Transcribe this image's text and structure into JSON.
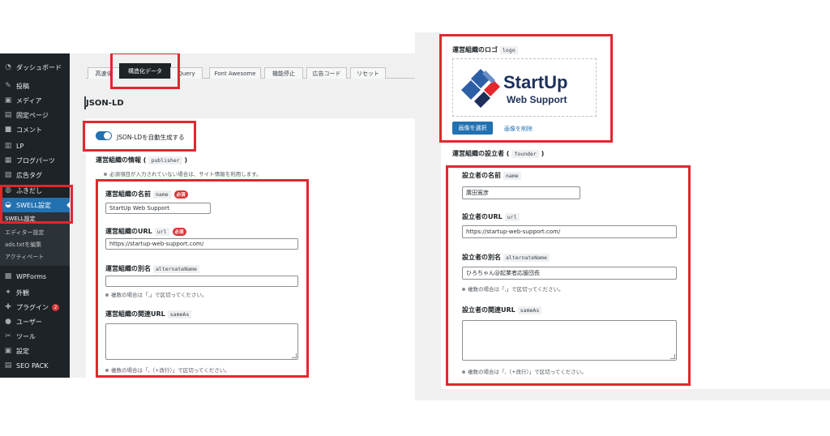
{
  "sidebar": {
    "items": [
      {
        "icon": "dashboard-icon",
        "glyph": "◔",
        "label": "ダッシュボード"
      },
      {
        "icon": "pin-icon",
        "glyph": "✎",
        "label": "投稿"
      },
      {
        "icon": "media-icon",
        "glyph": "▣",
        "label": "メディア"
      },
      {
        "icon": "page-icon",
        "glyph": "▤",
        "label": "固定ページ"
      },
      {
        "icon": "comment-icon",
        "glyph": "■",
        "label": "コメント"
      },
      {
        "icon": "lp-icon",
        "glyph": "▥",
        "label": "LP"
      },
      {
        "icon": "blog-parts-icon",
        "glyph": "▦",
        "label": "ブログパーツ"
      },
      {
        "icon": "ad-tag-icon",
        "glyph": "▧",
        "label": "広告タグ"
      },
      {
        "icon": "balloon-icon",
        "glyph": "◍",
        "label": "ふきだし"
      },
      {
        "icon": "swell-icon",
        "glyph": "◒",
        "label": "SWELL設定"
      }
    ],
    "submenu_head": "SWELL設定",
    "submenu": [
      "エディター設定",
      "ads.txtを編集",
      "アクティベート"
    ],
    "items2": [
      {
        "icon": "wpforms-icon",
        "glyph": "▩",
        "label": "WPForms"
      },
      {
        "icon": "appearance-icon",
        "glyph": "✦",
        "label": "外観"
      },
      {
        "icon": "plugin-icon",
        "glyph": "✚",
        "label": "プラグイン",
        "badge": "2"
      },
      {
        "icon": "users-icon",
        "glyph": "●",
        "label": "ユーザー"
      },
      {
        "icon": "tools-icon",
        "glyph": "✂",
        "label": "ツール"
      },
      {
        "icon": "settings-icon",
        "glyph": "▣",
        "label": "設定"
      },
      {
        "icon": "seo-pack-icon",
        "glyph": "▤",
        "label": "SEO PACK"
      }
    ]
  },
  "tabs": [
    "高速化",
    "構造化データ",
    "Query",
    "Font Awesome",
    "機能停止",
    "広告コード",
    "リセット"
  ],
  "section_title": "JSON-LD",
  "toggle_label": "JSON-LDを自動生成する",
  "publisher": {
    "heading": "運営組織の情報",
    "code": "publisher",
    "note": "必須項目が入力されていない場合は、サイト情報を利用します。",
    "name_label": "運営組織の名前",
    "name_code": "name",
    "required": "必須",
    "name_value": "StartUp Web Support",
    "url_label": "運営組織のURL",
    "url_code": "url",
    "url_value": "https://startup-web-support.com/",
    "alt_label": "運営組織の別名",
    "alt_code": "alternateName",
    "alt_note": "複数の場合は「,」で区切ってください。",
    "sameas_label": "運営組織の関連URL",
    "sameas_code": "sameAs",
    "sameas_note": "複数の場合は「,（+改行）」で区切ってください。"
  },
  "logo": {
    "label": "運営組織のロゴ",
    "code": "logo",
    "brand_line1": "StartUp",
    "brand_line2": "Web Support",
    "select_button": "画像を選択",
    "delete_button": "画像を削除"
  },
  "founder": {
    "heading": "運営組織の設立者",
    "code": "founder",
    "name_label": "設立者の名前",
    "name_code": "name",
    "name_value": "廣田寛彦",
    "url_label": "設立者のURL",
    "url_code": "url",
    "url_value": "https://startup-web-support.com/",
    "alt_label": "設立者の別名",
    "alt_code": "alternateName",
    "alt_value": "ひろちゃん@起業者応援団長",
    "alt_note": "複数の場合は「,」で区切ってください。",
    "sameas_label": "設立者の関連URL",
    "sameas_code": "sameAs",
    "sameas_note": "複数の場合は「,（+改行）」で区切ってください。"
  },
  "colors": {
    "accent": "#2271b1",
    "highlight": "#e0282e",
    "sidebar": "#1d2327"
  }
}
